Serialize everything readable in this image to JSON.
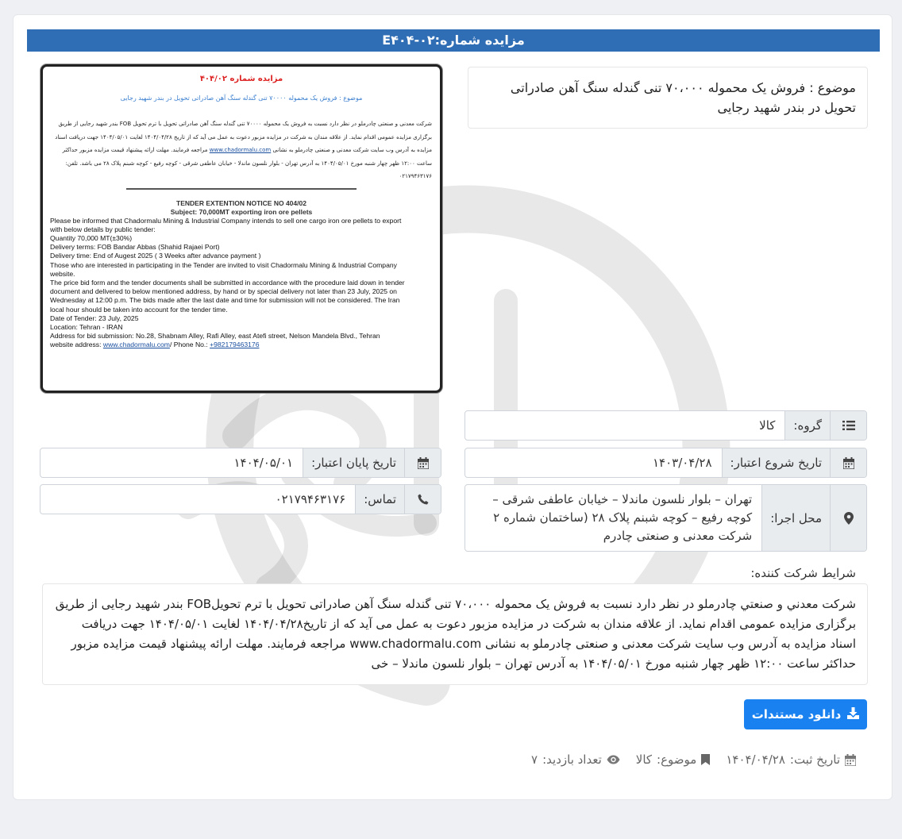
{
  "header": {
    "title": "مزایده شماره:E۴۰۴-۰۲"
  },
  "subject": {
    "text": "موضوع : فروش یک محموله ۷۰،۰۰۰ تنی گندله سنگ آهن صادراتی تحویل در بندر شهید رجایی"
  },
  "fields": {
    "group": {
      "label": "گروه:",
      "value": "کالا"
    },
    "start_date": {
      "label": "تاریخ شروع اعتبار:",
      "value": "۱۴۰۳/۰۴/۲۸"
    },
    "end_date": {
      "label": "تاریخ پایان اعتبار:",
      "value": "۱۴۰۴/۰۵/۰۱"
    },
    "location": {
      "label": "محل اجرا:",
      "value": "تهران – بلوار نلسون ماندلا – خیابان عاطفی شرقی – کوچه رفیع – کوچه شبنم پلاک ۲۸ (ساختمان شماره ۲ شرکت معدنی و صنعتی چادرم"
    },
    "contact": {
      "label": "تماس:",
      "value": "۰۲۱۷۹۴۶۳۱۷۶"
    }
  },
  "conditions": {
    "label": "شرایط شرکت کننده:",
    "text": "شرکت معدني و صنعتي چادرملو در نظر دارد نسبت به فروش یک محموله ۷۰،۰۰۰ تنی گندله سنگ آهن صادراتی تحویل با ترم تحویلFOB بندر شهید رجایی از طریق برگزاری مزایده عمومی اقدام نماید. از علاقه مندان به شرکت در مزایده مزبور دعوت به عمل می آید که از تاریخ۱۴۰۴/۰۴/۲۸ لغایت ۱۴۰۴/۰۵/۰۱ جهت دریافت اسناد مزایده به آدرس وب سایت شرکت معدنی و صنعتی چادرملو به نشانی www.chadormalu.com مراجعه فرمایند. مهلت ارائه پیشنهاد قیمت مزایده مزبور حداکثر ساعت ۱۲:۰۰ ظهر چهار شنبه مورخ ۱۴۰۴/۰۵/۰۱ به آدرس تهران – بلوار نلسون ماندلا – خی"
  },
  "download": {
    "label": "دانلود مستندات"
  },
  "meta": {
    "reg_label": "تاریخ ثبت:",
    "reg_value": "۱۴۰۴/۰۴/۲۸",
    "subject_label": "موضوع:",
    "subject_value": "کالا",
    "views_label": "تعداد بازدید:",
    "views_value": "۷"
  },
  "poster": {
    "fa_title": "مزایده شماره ۴۰۴/۰۲",
    "fa_subject": "موضوع : فروش یک محموله ۷۰۰۰۰ تنی گندله سنگ آهن صادراتی تحویل در بندر شهید رجایی",
    "fa_para": "شرکت معدنی و صنعتی چادرملو در نظر دارد نسبت به فروش یک محموله ۷۰۰۰۰ تنی گندله سنگ آهن صادراتی تحویل با ترم تحویل FOB بندر شهید رجایی از طریق برگزاری مزایده عمومی اقدام نماید. از علاقه مندان به شرکت در مزایده مزبور دعوت به عمل می آید که از تاریخ ۱۴۰۴/۰۴/۲۸ لغایت ۱۴۰۴/۰۵/۰۱ جهت دریافت اسناد مزایده به آدرس وب سایت شرکت معدنی و صنعتی چادرملو به نشانی",
    "fa_link": "www.chadormalu.com",
    "fa_para2": "مراجعه فرمایند. مهلت ارائه پیشنهاد قیمت مزایده مزبور حداکثر ساعت ۱۲:۰۰ ظهر چهار شنبه مورخ ۱۴۰۴/۰۵/۰۱ به آدرس تهران - بلوار نلسون ماندلا - خیابان عاطفی شرقی - کوچه رفیع - کوچه شبنم پلاک ۲۸ می باشد. تلفن: ۰۲۱۷۹۴۶۳۱۷۶",
    "en_title": "TENDER EXTENTION NOTICE NO 404/02",
    "en_subject": "Subject: 70,000MT exporting iron ore pellets",
    "en_lines": [
      "Please be informed that Chadormalu Mining & Industrial Company intends to sell one cargo iron ore pellets to export",
      "with below details by public tender:",
      "Quantity 70,000 MT(±30%)",
      "Delivery terms: FOB Bandar Abbas (Shahid Rajaei Port)",
      "Delivery time:  End of Augest 2025 ( 3 Weeks after advance payment )",
      "Those who are interested in participating in the Tender are invited to visit Chadormalu Mining & Industrial Company",
      "website.",
      "The price bid form and the tender documents shall be submitted in accordance with the procedure laid down in tender",
      "document and delivered to below mentioned address, by hand or by special delivery not later than 23 July, 2025 on",
      "Wednesday at 12:00 p.m. The bids made after the last date and time for submission will not be considered. The Iran",
      "local hour should be taken into account for the tender time.",
      "Date of Tender:  23 July, 2025",
      "Location: Tehran - IRAN",
      "Address for bid submission: No.28, Shabnam Alley, Rafi Alley, east Atefi street, Nelson Mandela Blvd., Tehran"
    ],
    "en_site_prefix": "website address: ",
    "en_site": "www.chadormalu.com",
    "en_phone_prefix": "/ Phone No.: ",
    "en_phone": "+982179463176"
  },
  "colors": {
    "title_bar": "#2f6db5",
    "download_button": "#1a82f0",
    "poster_title": "#dd2222",
    "poster_subject": "#3b7fd0"
  },
  "icons": [
    "list-icon",
    "calendar-icon",
    "map-marker-icon",
    "phone-icon",
    "download-icon",
    "bookmark-icon",
    "eye-icon"
  ]
}
